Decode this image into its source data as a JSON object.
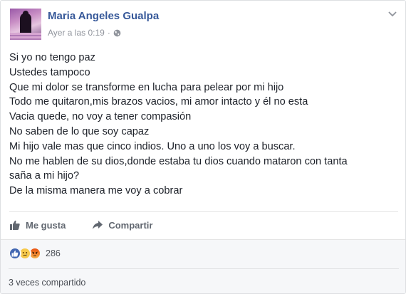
{
  "post": {
    "author": "Maria Angeles Gualpa",
    "timestamp": "Ayer a las 0:19",
    "separator": "·",
    "privacy_icon": "globe-icon",
    "menu_icon": "chevron-down-icon",
    "lines": [
      "Si yo no tengo paz",
      "Ustedes tampoco",
      "Que mi dolor se transforme en lucha para pelear por mi hijo",
      "Todo me quitaron,mis brazos vacios, mi amor intacto y él no esta",
      "Vacia quede, no voy a tener compasión",
      "No saben de lo que soy capaz",
      "Mi hijo vale mas que cinco indios. Uno a uno los voy a buscar.",
      "No me hablen de su dios,donde estaba tu dios cuando mataron con tanta",
      "saña a mi hijo?",
      "De la misma manera me voy a cobrar"
    ]
  },
  "actions": {
    "like_label": "Me gusta",
    "share_label": "Compartir"
  },
  "reactions": {
    "types": [
      "like",
      "sad",
      "angry"
    ],
    "count": "286"
  },
  "shares": {
    "text": "3 veces compartido"
  },
  "colors": {
    "author": "#365899",
    "meta": "#90949c",
    "text": "#1d2129",
    "like_blue": "#4267b2",
    "reaction_yellow": "#f7c94b",
    "reaction_angry": "#e9710f"
  }
}
